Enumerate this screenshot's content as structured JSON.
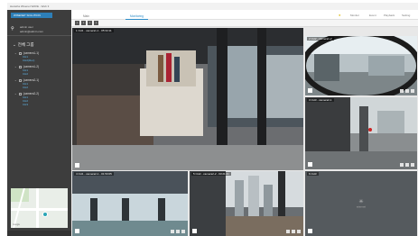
{
  "window": {
    "title": "Hanwha Wisenet WAVE - Web 3"
  },
  "sidebar": {
    "logo": "WISENET SOLUTION",
    "user": {
      "name": "admin user",
      "sub": "admin@admin.com"
    },
    "tree_root": "전체 그룹",
    "groups": [
      {
        "name": "(camera1-1)",
        "cams": [
          "CH1",
          "CH2(Rec)"
        ]
      },
      {
        "name": "(camera1-2)",
        "cams": [
          "CH1",
          "CH2"
        ]
      },
      {
        "name": "(camera2-1)",
        "cams": [
          "CH1",
          "CH2"
        ]
      },
      {
        "name": "(camera2-2)",
        "cams": [
          "CH1",
          "CH2",
          "CH3"
        ]
      }
    ],
    "map_label": "Google"
  },
  "topbar": {
    "tabs": [
      "Main",
      "Monitoring"
    ],
    "links": [
      "Monitor",
      "Event",
      "Playback",
      "Setting"
    ]
  },
  "tiles": [
    {
      "label": "1 CH1 - camera1-1 - 05:34:11",
      "selected": false
    },
    {
      "label": "2 CH2 - camera1-2",
      "selected": false
    },
    {
      "label": "3 CH3 - camera2-1",
      "selected": false
    },
    {
      "label": "4 CH1 - camera2-1 - 01:53:05",
      "selected": true
    },
    {
      "label": "5 CH2 - camera2-2 - 03:21:21",
      "selected": false
    },
    {
      "label": "6 CH3",
      "selected": false
    }
  ],
  "empty_tile": {
    "text": "wisenet"
  },
  "colors": {
    "accent": "#2a8bc7",
    "select": "#3fb6e4",
    "sidebar": "#3d3d3d"
  }
}
